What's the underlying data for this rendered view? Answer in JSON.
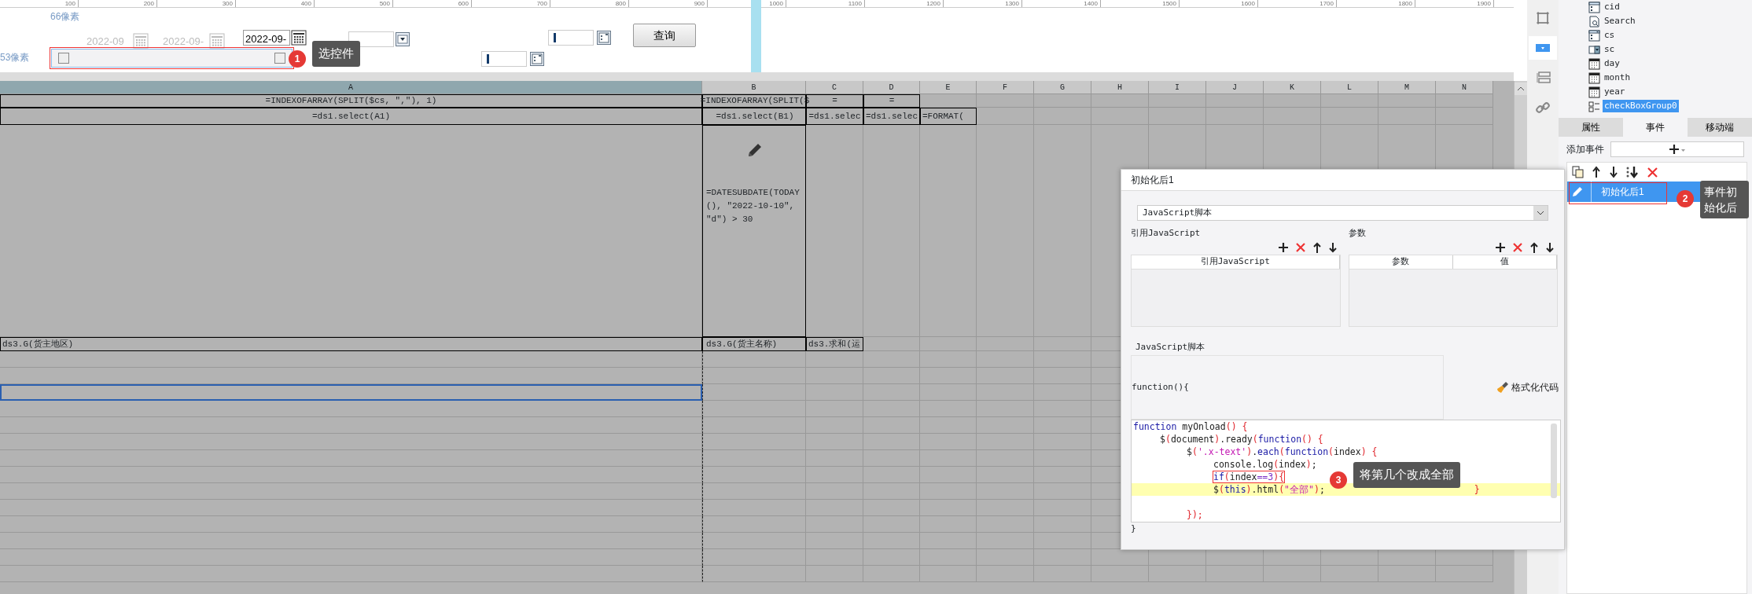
{
  "ruler": {
    "ticks": [
      "100",
      "200",
      "300",
      "400",
      "500",
      "600",
      "700",
      "800",
      "900",
      "1000",
      "1100",
      "1200",
      "1300",
      "1400",
      "1500",
      "1600",
      "1700",
      "1800",
      "1900"
    ]
  },
  "form_canvas": {
    "margin_labels": [
      "66像素",
      "53像素"
    ],
    "date_fields": [
      {
        "value": "2022-09",
        "disabled": true
      },
      {
        "value": "2022-09-",
        "disabled": true
      },
      {
        "value": "2022-09-",
        "disabled": false
      }
    ],
    "query_button": "查询",
    "checkbox_group": {
      "selected": true,
      "checkboxes": [
        {
          "checked": false
        },
        {
          "checked": false
        }
      ]
    },
    "annotation": {
      "number": "1",
      "text": "选控件"
    }
  },
  "sheet": {
    "columns": [
      {
        "label": "A",
        "selected": true
      },
      {
        "label": "B",
        "selected": false
      },
      {
        "label": "C",
        "selected": false
      },
      {
        "label": "D",
        "selected": false
      },
      {
        "label": "E",
        "selected": false
      },
      {
        "label": "F",
        "selected": false
      },
      {
        "label": "G",
        "selected": false
      },
      {
        "label": "H",
        "selected": false
      },
      {
        "label": "I",
        "selected": false
      },
      {
        "label": "J",
        "selected": false
      },
      {
        "label": "K",
        "selected": false
      },
      {
        "label": "L",
        "selected": false
      },
      {
        "label": "M",
        "selected": false
      },
      {
        "label": "N",
        "selected": false
      }
    ],
    "rows": [
      {
        "kind": "formula",
        "selected": false,
        "cells": [
          {
            "text": "=INDEXOFARRAY(SPLIT($cs, \",\"), 1)"
          },
          {
            "text": "=INDEXOFARRAY(SPLIT($"
          },
          {
            "text": "="
          },
          {
            "text": "="
          }
        ]
      },
      {
        "kind": "formula",
        "selected": false,
        "cells": [
          {
            "text": "=ds1.select(A1)"
          },
          {
            "text": "=ds1.select(B1)"
          },
          {
            "text": "=ds1.selec"
          },
          {
            "text": "=ds1.selec"
          },
          {
            "text": "=FORMAT("
          }
        ]
      },
      {
        "kind": "tall",
        "selected": false,
        "cells": [
          {},
          {
            "text": "=DATESUBDATE(TODAY(), \"2022-10-10\", \"d\") > 30"
          }
        ]
      },
      {
        "kind": "formula",
        "selected": false,
        "cells": [
          {
            "text": "ds3.G(货主地区)"
          },
          {
            "text": "ds3.G(货主名称)"
          },
          {
            "text": "ds3.求和(运"
          }
        ]
      },
      {
        "kind": "blank",
        "selected": false
      },
      {
        "kind": "blank",
        "selected": false
      },
      {
        "kind": "blank",
        "selected": true
      },
      {
        "kind": "blank",
        "selected": false
      },
      {
        "kind": "blank",
        "selected": false
      },
      {
        "kind": "blank",
        "selected": false
      },
      {
        "kind": "blank",
        "selected": false
      },
      {
        "kind": "blank",
        "selected": false
      },
      {
        "kind": "blank",
        "selected": false
      },
      {
        "kind": "blank",
        "selected": false
      },
      {
        "kind": "blank",
        "selected": false
      },
      {
        "kind": "blank",
        "selected": false
      },
      {
        "kind": "blank",
        "selected": false
      },
      {
        "kind": "blank",
        "selected": false
      }
    ]
  },
  "dialog": {
    "title": "初始化后1",
    "type_select": "JavaScript脚本",
    "references": {
      "title": "引用JavaScript",
      "columns": [
        "引用JavaScript"
      ]
    },
    "parameters": {
      "title": "参数",
      "columns": [
        "参数",
        "值"
      ]
    },
    "script": {
      "title": "JavaScript脚本",
      "header": "function(){",
      "format_button": "格式化代码",
      "footer": "}",
      "lines": [
        {
          "kind": "code",
          "highlighted": false,
          "outlined": false,
          "tokens": [
            {
              "kind": "kw",
              "text": "function"
            },
            {
              "kind": "plain",
              "text": " myOnload"
            },
            {
              "kind": "punct",
              "text": "() {"
            }
          ],
          "children": [
            {
              "kind": "code",
              "highlighted": false,
              "outlined": false,
              "tokens": [
                {
                  "kind": "plain",
                  "text": "$"
                },
                {
                  "kind": "punct",
                  "text": "("
                },
                {
                  "kind": "plain",
                  "text": "document"
                },
                {
                  "kind": "punct",
                  "text": ")"
                },
                {
                  "kind": "plain",
                  "text": ".ready"
                },
                {
                  "kind": "punct",
                  "text": "("
                },
                {
                  "kind": "kw",
                  "text": "function"
                },
                {
                  "kind": "punct",
                  "text": "() {"
                }
              ],
              "children": [
                {
                  "kind": "code",
                  "highlighted": false,
                  "outlined": false,
                  "tokens": [
                    {
                      "kind": "plain",
                      "text": "$"
                    },
                    {
                      "kind": "punct",
                      "text": "("
                    },
                    {
                      "kind": "str",
                      "text": "'.x-text'"
                    },
                    {
                      "kind": "punct",
                      "text": ")"
                    },
                    {
                      "kind": "plain",
                      "text": "."
                    },
                    {
                      "kind": "kw",
                      "text": "each"
                    },
                    {
                      "kind": "punct",
                      "text": "("
                    },
                    {
                      "kind": "kw",
                      "text": "function"
                    },
                    {
                      "kind": "punct",
                      "text": "("
                    },
                    {
                      "kind": "plain",
                      "text": "index"
                    },
                    {
                      "kind": "punct",
                      "text": ") {"
                    }
                  ],
                  "children": [
                    {
                      "kind": "code",
                      "highlighted": false,
                      "outlined": false,
                      "tokens": [
                        {
                          "kind": "plain",
                          "text": "console.log"
                        },
                        {
                          "kind": "punct",
                          "text": "("
                        },
                        {
                          "kind": "plain",
                          "text": "index"
                        },
                        {
                          "kind": "punct",
                          "text": ")"
                        },
                        {
                          "kind": "plain",
                          "text": ";"
                        }
                      ]
                    },
                    {
                      "kind": "code",
                      "highlighted": false,
                      "outlined": true,
                      "tokens": [
                        {
                          "kind": "kw",
                          "text": "if"
                        },
                        {
                          "kind": "punct",
                          "text": "("
                        },
                        {
                          "kind": "plain",
                          "text": "index"
                        },
                        {
                          "kind": "num",
                          "text": "==3"
                        },
                        {
                          "kind": "punct",
                          "text": "){"
                        }
                      ]
                    },
                    {
                      "kind": "code",
                      "highlighted": true,
                      "outlined": false,
                      "tokens": [
                        {
                          "kind": "plain",
                          "text": "$"
                        },
                        {
                          "kind": "punct",
                          "text": "("
                        },
                        {
                          "kind": "kw",
                          "text": "this"
                        },
                        {
                          "kind": "punct",
                          "text": ")"
                        },
                        {
                          "kind": "plain",
                          "text": ".html"
                        },
                        {
                          "kind": "punct",
                          "text": "("
                        },
                        {
                          "kind": "str",
                          "text": "\"全部\""
                        },
                        {
                          "kind": "punct",
                          "text": ")"
                        },
                        {
                          "kind": "plain",
                          "text": ";"
                        },
                        {
                          "kind": "far-punct",
                          "text": "}"
                        }
                      ]
                    }
                  ]
                },
                {
                  "kind": "blank"
                },
                {
                  "kind": "code",
                  "highlighted": false,
                  "outlined": false,
                  "tokens": [
                    {
                      "kind": "punct",
                      "text": "});"
                    }
                  ]
                }
              ]
            }
          ]
        }
      ],
      "annotation": {
        "number": "3",
        "text": "将第几个改成全部"
      }
    }
  },
  "side_toolbar": {
    "items": [
      {
        "kind": "frame",
        "selected": false
      },
      {
        "kind": "dropdown",
        "selected": true
      },
      {
        "kind": "list",
        "selected": false
      },
      {
        "kind": "link",
        "selected": false
      }
    ]
  },
  "right_panel": {
    "tree": [
      {
        "label": "cid",
        "kind": "form",
        "selected": false
      },
      {
        "label": "Search",
        "kind": "search",
        "selected": false
      },
      {
        "label": "cs",
        "kind": "combo",
        "selected": false
      },
      {
        "label": "sc",
        "kind": "dropdown",
        "selected": false
      },
      {
        "label": "day",
        "kind": "date",
        "selected": false
      },
      {
        "label": "month",
        "kind": "date",
        "selected": false
      },
      {
        "label": "year",
        "kind": "date",
        "selected": false
      },
      {
        "label": "checkBoxGroup0",
        "kind": "checkbox-group",
        "selected": true
      }
    ],
    "tabs": [
      {
        "label": "属性",
        "selected": false
      },
      {
        "label": "事件",
        "selected": true
      },
      {
        "label": "移动端",
        "selected": false
      }
    ],
    "add_event_label": "添加事件",
    "events": [
      {
        "label": "初始化后1",
        "selected": true
      }
    ],
    "annotation": {
      "number": "2",
      "text": "事件初始化后"
    }
  }
}
